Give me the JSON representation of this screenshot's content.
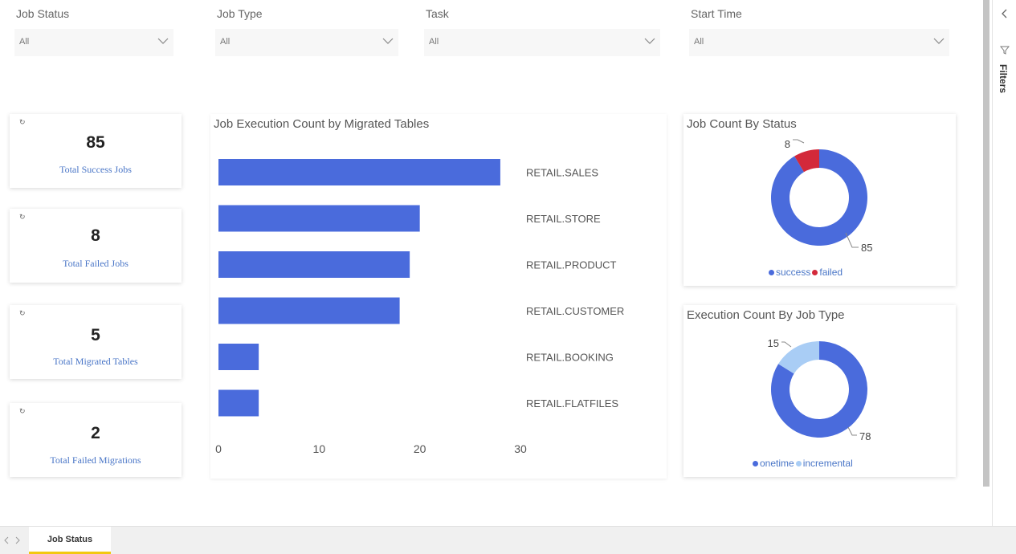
{
  "filters": {
    "job_status": {
      "label": "Job Status",
      "value": "All"
    },
    "job_type": {
      "label": "Job Type",
      "value": "All"
    },
    "task": {
      "label": "Task",
      "value": "All"
    },
    "start_time": {
      "label": "Start Time",
      "value": "All"
    }
  },
  "kpis": [
    {
      "value": "85",
      "caption": "Total Success Jobs"
    },
    {
      "value": "8",
      "caption": "Total Failed Jobs"
    },
    {
      "value": "5",
      "caption": "Total Migrated Tables"
    },
    {
      "value": "2",
      "caption": "Total Failed Migrations"
    }
  ],
  "visuals": {
    "bar_title": "Job Execution Count by Migrated Tables",
    "status_title": "Job Count By Status",
    "type_title": "Execution Count By Job Type"
  },
  "colors": {
    "primary": "#4a6bdc",
    "failed": "#d3293a",
    "incremental": "#a9cdf5",
    "accent_tab": "#f2c811"
  },
  "chart_data": [
    {
      "type": "bar",
      "orientation": "horizontal",
      "title": "Job Execution Count by Migrated Tables",
      "categories": [
        "RETAIL.SALES",
        "RETAIL.STORE",
        "RETAIL.PRODUCT",
        "RETAIL.CUSTOMER",
        "RETAIL.BOOKING",
        "RETAIL.FLATFILES"
      ],
      "values": [
        28,
        20,
        19,
        18,
        4,
        4
      ],
      "xlim": [
        0,
        30
      ],
      "xticks": [
        "0",
        "10",
        "20",
        "30"
      ],
      "grid": false
    },
    {
      "type": "pie",
      "donut": true,
      "title": "Job Count By Status",
      "labels": [
        "success",
        "failed"
      ],
      "values": [
        85,
        8
      ],
      "legend": "bottom"
    },
    {
      "type": "pie",
      "donut": true,
      "title": "Execution Count By Job Type",
      "labels": [
        "onetime",
        "incremental"
      ],
      "values": [
        78,
        15
      ],
      "legend": "bottom"
    }
  ],
  "side_pane": {
    "label": "Filters",
    "icons": [
      "chevron-left-icon",
      "filter-icon"
    ]
  },
  "tabs": [
    {
      "label": "Job Status",
      "active": true
    }
  ],
  "nav_icons": [
    "prev-page-icon",
    "next-page-icon"
  ]
}
